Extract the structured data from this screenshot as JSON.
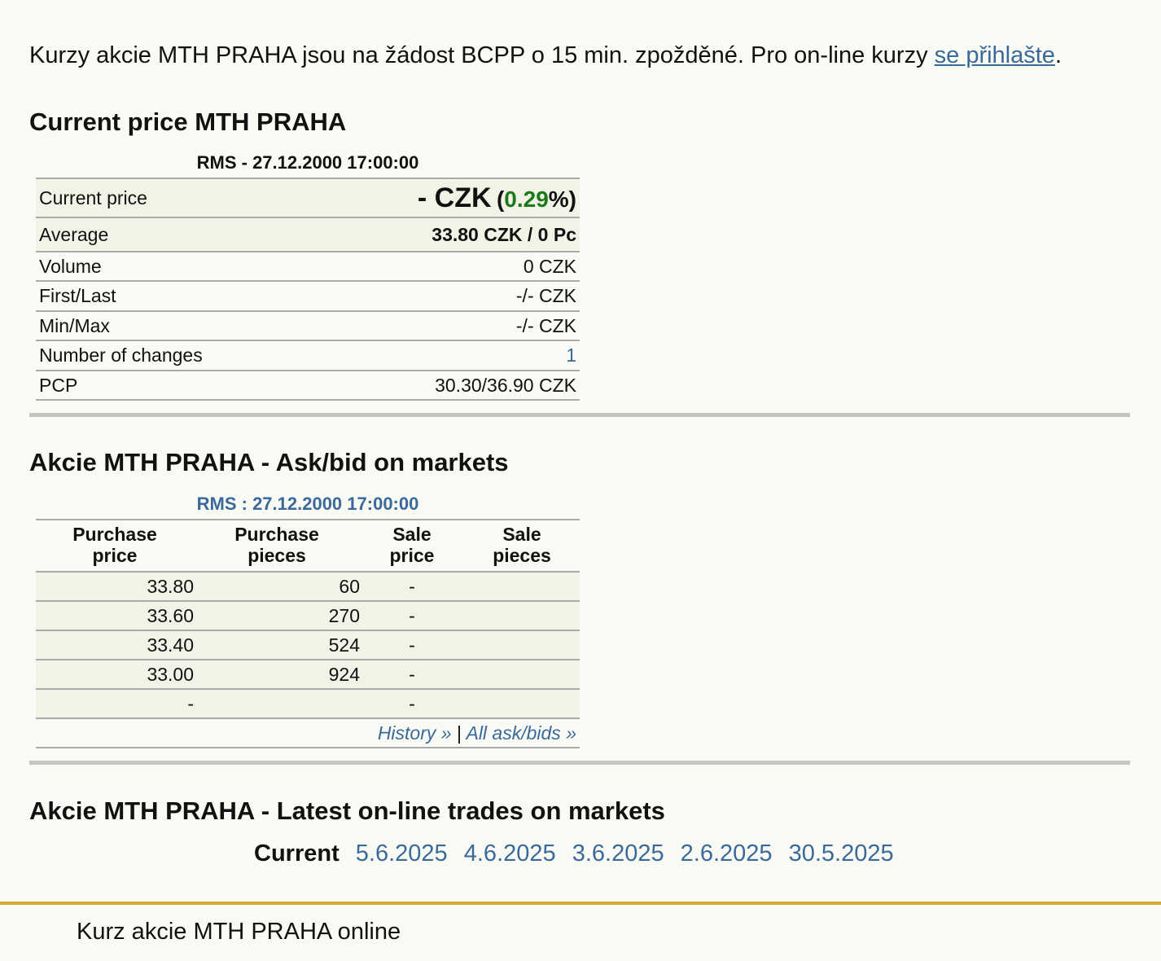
{
  "notice": {
    "text": "Kurzy akcie MTH PRAHA jsou na žádost BCPP o 15 min. zpožděné. Pro on-line kurzy ",
    "link": "se přihlašte",
    "end": "."
  },
  "current": {
    "title": "Current price MTH PRAHA",
    "caption": "RMS - 27.12.2000 17:00:00",
    "rows": [
      {
        "label": "Current price",
        "value": "- CZK",
        "change_open": "(",
        "change": "0.29",
        "change_close": "%)"
      },
      {
        "label": "Average",
        "value": "33.80 CZK / 0 Pc"
      },
      {
        "label": "Volume",
        "value": "0 CZK"
      },
      {
        "label": "First/Last",
        "value": "-/- CZK"
      },
      {
        "label": "Min/Max",
        "value": "-/- CZK"
      },
      {
        "label": "Number of changes",
        "value": "1"
      },
      {
        "label": "PCP",
        "value": "30.30/36.90 CZK"
      }
    ]
  },
  "askbid": {
    "title": "Akcie MTH PRAHA - Ask/bid on markets",
    "caption": "RMS : 27.12.2000 17:00:00",
    "headers": [
      "Purchase\nprice",
      "Purchase\npieces",
      "Sale\nprice",
      "Sale\npieces"
    ],
    "rows": [
      [
        "33.80",
        "60",
        "-",
        ""
      ],
      [
        "33.60",
        "270",
        "-",
        ""
      ],
      [
        "33.40",
        "524",
        "-",
        ""
      ],
      [
        "33.00",
        "924",
        "-",
        ""
      ],
      [
        "-",
        "",
        "-",
        ""
      ]
    ],
    "history_link": "History »",
    "link_sep": "|",
    "all_link": "All ask/bids »"
  },
  "latest": {
    "title": "Akcie MTH PRAHA - Latest on-line trades on markets",
    "current_label": "Current",
    "dates": [
      "5.6.2025",
      "4.6.2025",
      "3.6.2025",
      "2.6.2025",
      "30.5.2025"
    ]
  },
  "footer": {
    "text": "Kurz akcie MTH PRAHA online"
  },
  "colors": {
    "link": "#3a6a9a",
    "positive": "#1a7a1a",
    "gold": "#d4aa30",
    "separator": "#c4c4c4"
  }
}
